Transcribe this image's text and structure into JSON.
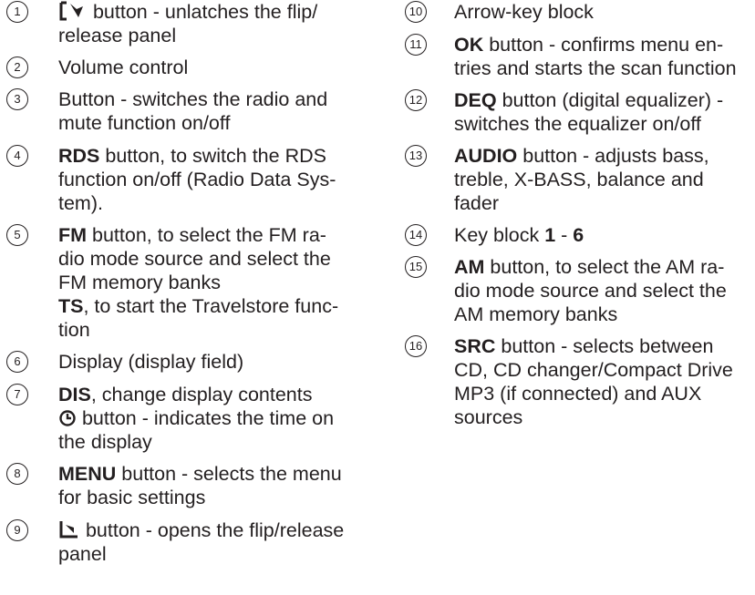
{
  "left": [
    {
      "num": "1",
      "lines": [
        [
          "",
          " button - unlatches the flip/"
        ],
        [
          "release panel"
        ]
      ]
    },
    {
      "num": "2",
      "lines": [
        [
          "Volume control"
        ]
      ]
    },
    {
      "num": "3",
      "lines": [
        [
          "Button - switches the radio and"
        ],
        [
          "mute function on/off"
        ]
      ]
    },
    {
      "num": "4",
      "lines": [
        [
          "RDS",
          " button, to switch the RDS"
        ],
        [
          "function on/off (Radio Data Sys-"
        ],
        [
          "tem)."
        ]
      ]
    },
    {
      "num": "5",
      "lines": [
        [
          "FM",
          " button, to select the FM ra-"
        ],
        [
          "dio mode source and select the"
        ],
        [
          "FM memory banks"
        ],
        [
          "TS",
          ", to start the Travelstore func-"
        ],
        [
          "tion"
        ]
      ]
    },
    {
      "num": "6",
      "lines": [
        [
          "Display (display field)"
        ]
      ]
    },
    {
      "num": "7",
      "lines": [
        [
          "DIS",
          ", change display contents"
        ],
        [
          "",
          " button - indicates the time on"
        ],
        [
          "the display"
        ]
      ]
    },
    {
      "num": "8",
      "lines": [
        [
          "MENU",
          " button - selects the menu"
        ],
        [
          "for basic settings"
        ]
      ]
    },
    {
      "num": "9",
      "lines": [
        [
          "",
          " button - opens the flip/release"
        ],
        [
          "panel"
        ]
      ]
    }
  ],
  "right": [
    {
      "num": "10",
      "lines": [
        [
          "Arrow-key block"
        ]
      ]
    },
    {
      "num": "11",
      "lines": [
        [
          "OK",
          " button - confirms menu en-"
        ],
        [
          "tries and starts the scan function"
        ]
      ]
    },
    {
      "num": "12",
      "lines": [
        [
          "DEQ",
          " button (digital equalizer) -"
        ],
        [
          "switches the equalizer on/off"
        ]
      ]
    },
    {
      "num": "13",
      "lines": [
        [
          "AUDIO",
          " button - adjusts bass,"
        ],
        [
          "treble, X-BASS, balance and"
        ],
        [
          "fader"
        ]
      ]
    },
    {
      "num": "14",
      "lines": [
        [
          "Key block ",
          "1",
          " - ",
          "6"
        ]
      ]
    },
    {
      "num": "15",
      "lines": [
        [
          "AM",
          " button, to select the AM ra-"
        ],
        [
          "dio mode source and select the"
        ],
        [
          "AM memory banks"
        ]
      ]
    },
    {
      "num": "16",
      "lines": [
        [
          "SRC",
          " button - selects between"
        ],
        [
          "CD, CD changer/Compact Drive"
        ],
        [
          "MP3 (if connected) and AUX"
        ],
        [
          "sources"
        ]
      ]
    }
  ]
}
